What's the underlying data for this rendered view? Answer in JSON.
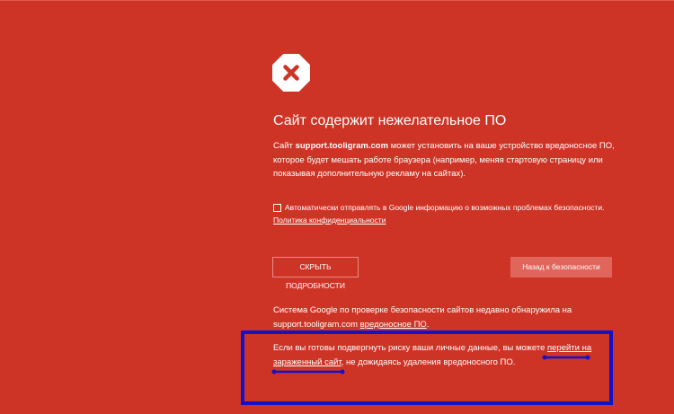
{
  "title": "Сайт содержит нежелательное ПО",
  "main_message": {
    "prefix": "Сайт ",
    "site": "support.tooligram.com",
    "suffix": " может установить на ваше устройство вредоносное ПО, которое будет мешать работе браузера (например, меняя стартовую страницу или показывая дополнительную рекламу на сайтах)."
  },
  "report_checkbox": {
    "checked": false,
    "label": "Автоматически отправлять в Google информацию о возможных проблемах безопасности.",
    "privacy_link": "Политика конфиденциальности"
  },
  "buttons": {
    "details": "СКРЫТЬ ПОДРОБНОСТИ",
    "back": "Назад к безопасности"
  },
  "details": {
    "p1_text": "Система Google по проверке безопасности сайтов недавно обнаружила на support.tooligram.com ",
    "p1_link": "вредоносное ПО",
    "p1_end": ".",
    "p2_text": "Если вы готовы подвергнуть риску ваши личные данные, вы можете ",
    "p2_link": "перейти на зараженный сайт",
    "p2_end": ", не дожидаясь удаления вредоносного ПО."
  },
  "annotation": {
    "highlight_color": "#1212c8"
  },
  "colors": {
    "background": "#ce3426",
    "primary_button": "#e0665b",
    "text": "#ffffff"
  },
  "icons": {
    "warning": "red-x-octagon-icon"
  }
}
